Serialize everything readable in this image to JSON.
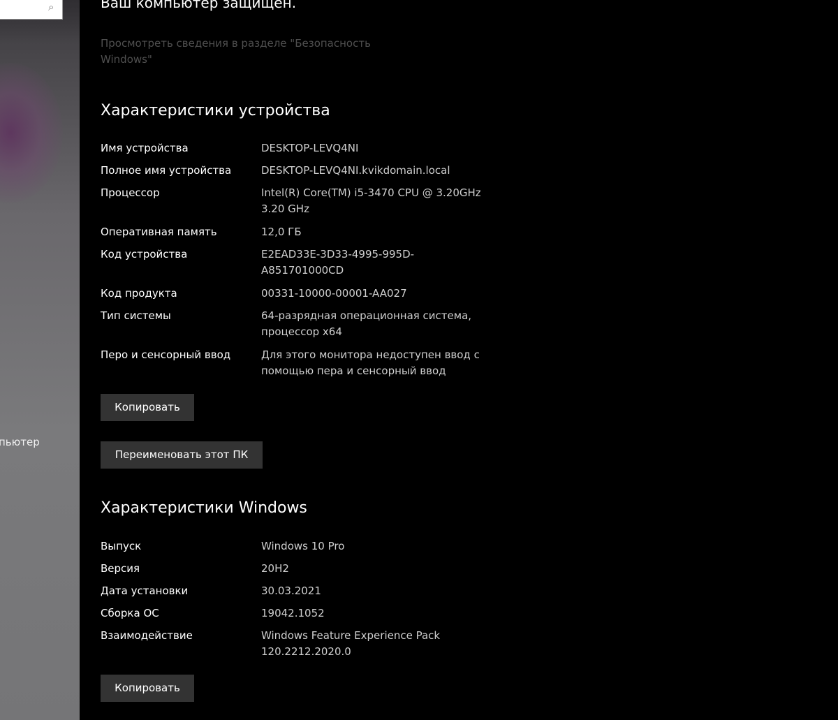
{
  "sidebar": {
    "search_icon": "search-icon",
    "item_computer_partial": "пьютер"
  },
  "main": {
    "protected_title": "Ваш компьютер защищен.",
    "security_link": "Просмотреть сведения в разделе \"Безопасность Windows\"",
    "device_section": {
      "title": "Характеристики устройства",
      "rows": [
        {
          "label": "Имя устройства",
          "value": "DESKTOP-LEVQ4NI"
        },
        {
          "label": "Полное имя устройства",
          "value": "DESKTOP-LEVQ4NI.kvikdomain.local"
        },
        {
          "label": "Процессор",
          "value": "Intel(R) Core(TM) i5-3470 CPU @ 3.20GHz 3.20 GHz"
        },
        {
          "label": "Оперативная память",
          "value": "12,0 ГБ"
        },
        {
          "label": "Код устройства",
          "value": "E2EAD33E-3D33-4995-995D-A851701000CD"
        },
        {
          "label": "Код продукта",
          "value": "00331-10000-00001-AA027"
        },
        {
          "label": "Тип системы",
          "value": "64-разрядная операционная система, процессор x64"
        },
        {
          "label": "Перо и сенсорный ввод",
          "value": "Для этого монитора недоступен ввод с помощью пера и сенсорный ввод"
        }
      ],
      "copy_button": "Копировать",
      "rename_button": "Переименовать этот ПК"
    },
    "windows_section": {
      "title": "Характеристики Windows",
      "rows": [
        {
          "label": "Выпуск",
          "value": "Windows 10 Pro"
        },
        {
          "label": "Версия",
          "value": "20H2"
        },
        {
          "label": "Дата установки",
          "value": "30.03.2021"
        },
        {
          "label": "Сборка ОС",
          "value": "19042.1052"
        },
        {
          "label": "Взаимодействие",
          "value": "Windows Feature Experience Pack 120.2212.2020.0"
        }
      ],
      "copy_button": "Копировать"
    }
  }
}
